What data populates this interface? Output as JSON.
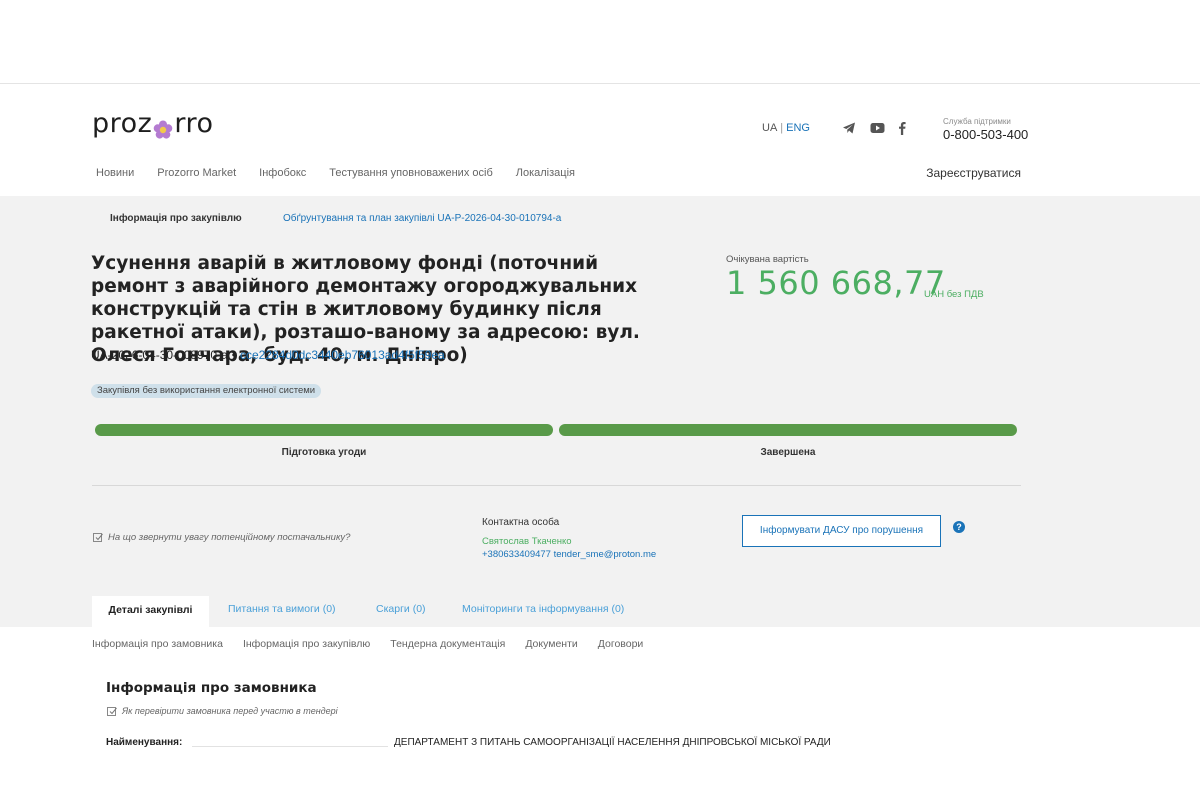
{
  "header": {
    "logo": {
      "left": "proz",
      "right": "rro"
    },
    "lang": {
      "ua": "UA",
      "separator": "|",
      "eng": "ENG"
    },
    "support": {
      "caption": "Служба підтримки",
      "phone": "0-800-503-400"
    },
    "nav": [
      "Новини",
      "Prozorro Market",
      "Інфобокс",
      "Тестування уповноважених осіб",
      "Локалізація"
    ],
    "register": "Зареєструватися"
  },
  "breadcrumbs": {
    "item1": "Інформація про закупівлю",
    "item2": "Обґрунтування та план закупівлі UA-P-2026-04-30-010794-a"
  },
  "tender": {
    "title": "Усунення аварій в житловому фонді (поточний ремонт з аварійного демонтажу огороджувальних конструкцій та стін в житловому будинку після ракетної атаки), розташо-ваному за адресою: вул. Олеся Гончара, буд. 40, м. Дніпро)",
    "id": "UA-2026-04-30-008970-a",
    "id_separator": "•",
    "hash": "cce2284d0dc3440eb76013ad4f5f59ea",
    "badge": "Закупівля без використання електронної системи",
    "expected_label": "Очікувана вартість",
    "expected_value": "1 560 668,77",
    "expected_unit": "UAH без ПДВ"
  },
  "progress": {
    "stages": [
      {
        "label": "Підготовка угоди",
        "completed": 1
      },
      {
        "label": "Завершена",
        "completed": 1
      }
    ]
  },
  "contact": {
    "hint": "На що звернути увагу потенційному постачальнику?",
    "caption": "Контактна особа",
    "name": "Святослав Ткаченко",
    "phone_email": "+380633409477 tender_sme@proton.me",
    "dasu_button": "Інформувати ДАСУ про порушення",
    "help": "?"
  },
  "tabs": {
    "active": "Деталі закупівлі",
    "questions": "Питання та вимоги (0)",
    "complaints": "Скарги (0)",
    "monitoring": "Моніторинги та інформування (0)"
  },
  "subnav": [
    "Інформація про замовника",
    "Інформація про закупівлю",
    "Тендерна документація",
    "Документи",
    "Договори"
  ],
  "customer": {
    "title": "Інформація про замовника",
    "hint": "Як перевірити замовника перед участю в тендері",
    "name_label": "Найменування:",
    "name_value": "ДЕПАРТАМЕНТ З ПИТАНЬ САМООРГАНІЗАЦІЇ НАСЕЛЕННЯ ДНІПРОВСЬКОЇ МІСЬКОЇ РАДИ"
  },
  "colors": {
    "green": "#599a49",
    "price": "#4cae62",
    "link": "#1a73b8",
    "band": "#f2f2f2"
  },
  "icons": [
    "flower-icon",
    "telegram-icon",
    "youtube-icon",
    "facebook-icon",
    "checkbox-icon",
    "help-icon"
  ]
}
